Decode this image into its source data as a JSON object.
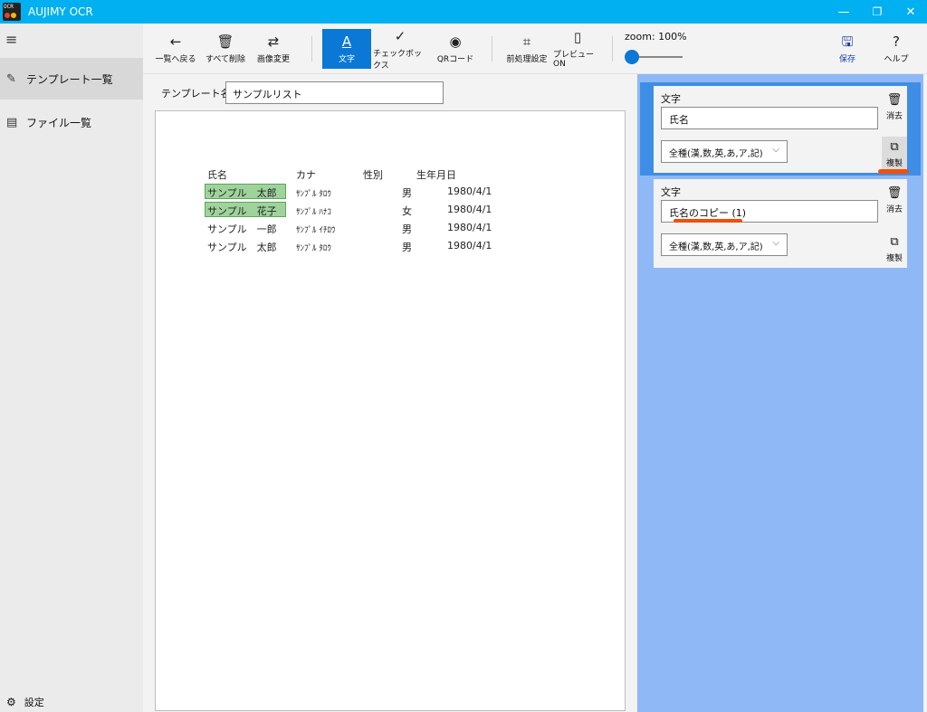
{
  "app": {
    "title": "AUJIMY OCR",
    "logo_text": "OCR",
    "accent_color": "#00b0f0",
    "window_controls": {
      "minimize": "—",
      "maximize": "❐",
      "close": "✕"
    }
  },
  "leftnav": {
    "menu_icon": "≡",
    "items": [
      {
        "label": "テンプレート一覧",
        "icon": "edit-icon",
        "glyph": "✎",
        "active": true
      },
      {
        "label": "ファイル一覧",
        "icon": "document-icon",
        "glyph": "▤",
        "active": false
      }
    ],
    "settings": {
      "label": "設定",
      "icon": "gear-icon",
      "glyph": "⚙"
    }
  },
  "toolbar": {
    "buttons": [
      {
        "label": "一覧へ戻る",
        "icon": "arrow-left-icon",
        "glyph": "←"
      },
      {
        "label": "すべて削除",
        "icon": "trash-icon",
        "glyph": "🗑"
      },
      {
        "label": "画像変更",
        "icon": "swap-icon",
        "glyph": "⇄"
      },
      {
        "label": "文字",
        "icon": "text-icon",
        "glyph": "A",
        "active": true
      },
      {
        "label": "チェックボックス",
        "icon": "checkmark-icon",
        "glyph": "✓"
      },
      {
        "label": "QRコード",
        "icon": "globe-icon",
        "glyph": "◉"
      },
      {
        "label": "前処理設定",
        "icon": "crop-icon",
        "glyph": "⌗"
      },
      {
        "label": "プレビューON",
        "icon": "page-icon",
        "glyph": "▯"
      }
    ],
    "zoom_label": "zoom:  100%",
    "zoom_value": 100,
    "save": {
      "label": "保存",
      "icon": "save-icon",
      "glyph": "🖫"
    },
    "help": {
      "label": "ヘルプ",
      "icon": "help-icon",
      "glyph": "?"
    }
  },
  "editor": {
    "template_name_label": "テンプレート名：",
    "template_name_value": "サンプルリスト",
    "document": {
      "headers": [
        "氏名",
        "カナ",
        "性別",
        "生年月日"
      ],
      "rows": [
        {
          "name": "サンプル　太郎",
          "kana": "ｻﾝﾌﾟﾙ ﾀﾛｳ",
          "gender": "男",
          "dob": "1980/4/1",
          "highlighted": true
        },
        {
          "name": "サンプル　花子",
          "kana": "ｻﾝﾌﾟﾙ ﾊﾅｺ",
          "gender": "女",
          "dob": "1980/4/1",
          "highlighted": true
        },
        {
          "name": "サンプル　一郎",
          "kana": "ｻﾝﾌﾟﾙ ｲﾁﾛｳ",
          "gender": "男",
          "dob": "1980/4/1",
          "highlighted": false
        },
        {
          "name": "サンプル　太郎",
          "kana": "ｻﾝﾌﾟﾙ ﾀﾛｳ",
          "gender": "男",
          "dob": "1980/4/1",
          "highlighted": false
        }
      ]
    }
  },
  "fields_panel": {
    "cards": [
      {
        "type_label": "文字",
        "name_value": "氏名",
        "charset": "全種(漢,数,英,あ,ア,記)",
        "delete_label": "消去",
        "duplicate_label": "複製",
        "selected": true
      },
      {
        "type_label": "文字",
        "name_value": "氏名のコピー (1)",
        "charset": "全種(漢,数,英,あ,ア,記)",
        "delete_label": "消去",
        "duplicate_label": "複製",
        "selected": false
      }
    ],
    "selected_color": "#3e8ee6",
    "panel_color": "#8fb8f7",
    "annotation_color": "#f0500a"
  }
}
